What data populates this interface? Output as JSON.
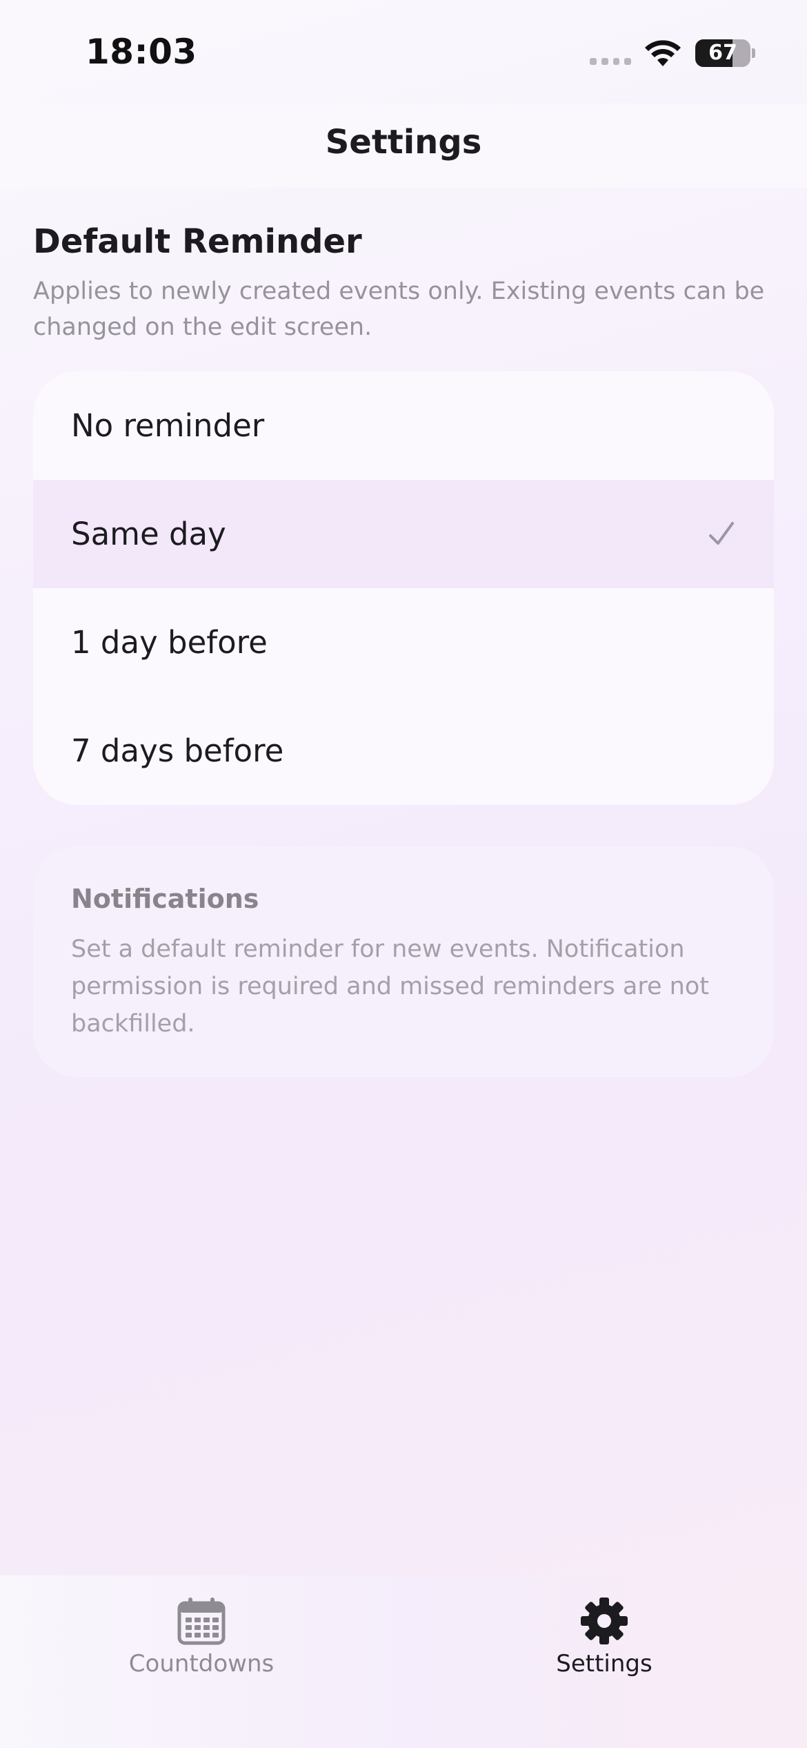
{
  "status_bar": {
    "time": "18:03",
    "battery_level": "67",
    "battery_fraction": 0.67
  },
  "nav": {
    "title": "Settings"
  },
  "section": {
    "title": "Default Reminder",
    "description": "Applies to newly created events only. Existing events can be changed on the edit screen."
  },
  "reminder_options": [
    {
      "label": "No reminder",
      "selected": false
    },
    {
      "label": "Same day",
      "selected": true
    },
    {
      "label": "1 day before",
      "selected": false
    },
    {
      "label": "7 days before",
      "selected": false
    }
  ],
  "info": {
    "title": "Notifications",
    "body": "Set a default reminder for new events. Notification permission is required and missed reminders are not backfilled."
  },
  "tab_bar": {
    "tabs": [
      {
        "label": "Countdowns",
        "icon": "calendar-icon",
        "active": false
      },
      {
        "label": "Settings",
        "icon": "gear-icon",
        "active": true
      }
    ]
  },
  "colors": {
    "selected_row": "#f2e8fa",
    "check": "#9a97a0",
    "active_tab": "#1c1b20",
    "inactive_tab": "#8e8b93"
  }
}
